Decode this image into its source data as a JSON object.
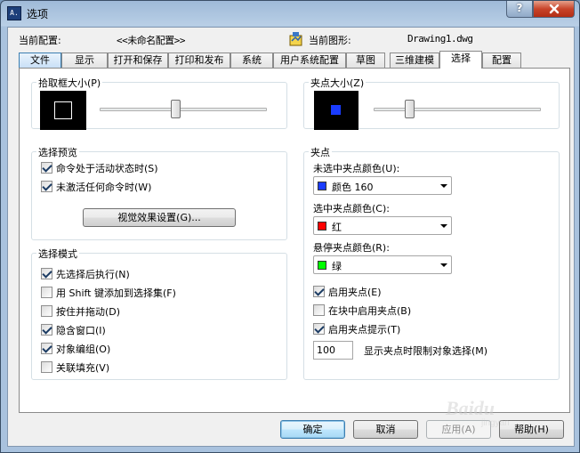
{
  "window": {
    "title": "选项",
    "app_icon_text": "A.",
    "help_label": "?",
    "close_label": "x"
  },
  "config": {
    "current_profile_label": "当前配置:",
    "current_profile_value": "<<未命名配置>>",
    "current_drawing_label": "当前图形:",
    "current_drawing_value": "Drawing1.dwg"
  },
  "tabs": [
    {
      "label": "文件"
    },
    {
      "label": "显示"
    },
    {
      "label": "打开和保存"
    },
    {
      "label": "打印和发布"
    },
    {
      "label": "系统"
    },
    {
      "label": "用户系统配置"
    },
    {
      "label": "草图"
    },
    {
      "label": "三维建模"
    },
    {
      "label": "选择"
    },
    {
      "label": "配置"
    }
  ],
  "pickbox": {
    "title": "拾取框大小(P)",
    "slider_level": 0.45
  },
  "grip_size": {
    "title": "夹点大小(Z)",
    "slider_level": 0.2
  },
  "selection_preview": {
    "title": "选择预览",
    "options": [
      {
        "label": "命令处于活动状态时(S)",
        "checked": true
      },
      {
        "label": "未激活任何命令时(W)",
        "checked": true
      }
    ],
    "visual_effects_button": "视觉效果设置(G)..."
  },
  "selection_mode": {
    "title": "选择模式",
    "options": [
      {
        "label": "先选择后执行(N)",
        "checked": true
      },
      {
        "label": "用 Shift 键添加到选择集(F)",
        "checked": false
      },
      {
        "label": "按住并拖动(D)",
        "checked": false
      },
      {
        "label": "隐含窗口(I)",
        "checked": true
      },
      {
        "label": "对象编组(O)",
        "checked": true
      },
      {
        "label": "关联填充(V)",
        "checked": false
      }
    ]
  },
  "grips": {
    "title": "夹点",
    "unselected_color_label": "未选中夹点颜色(U):",
    "unselected_color_value": "颜色 160",
    "unselected_color_hex": "#1a3cff",
    "selected_color_label": "选中夹点颜色(C):",
    "selected_color_value": "红",
    "selected_color_hex": "#ff0000",
    "hover_color_label": "悬停夹点颜色(R):",
    "hover_color_value": "绿",
    "hover_color_hex": "#00ff00",
    "options": [
      {
        "label": "启用夹点(E)",
        "checked": true
      },
      {
        "label": "在块中启用夹点(B)",
        "checked": false
      },
      {
        "label": "启用夹点提示(T)",
        "checked": true
      }
    ],
    "limit_value": "100",
    "limit_label": "显示夹点时限制对象选择(M)"
  },
  "footer": {
    "ok": "确定",
    "cancel": "取消",
    "apply": "应用(A)",
    "help": "帮助(H)"
  },
  "watermark": {
    "text": "Baidu",
    "sub": "jingyan"
  }
}
